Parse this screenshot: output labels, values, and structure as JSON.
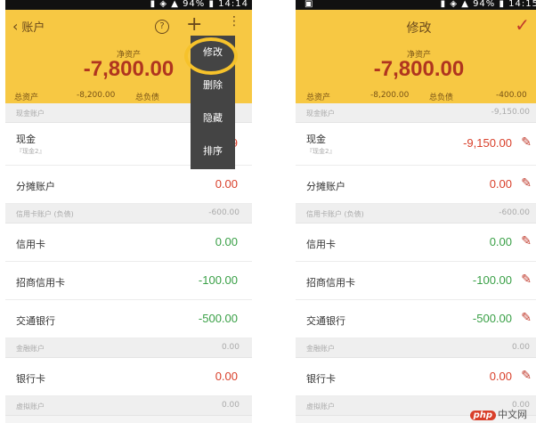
{
  "status_bar": {
    "time_left": "14:14",
    "time_right": "14:15",
    "battery": "94%"
  },
  "left": {
    "back_label": "账户",
    "net_label": "净资产",
    "net_value": "-7,800.00",
    "summary": {
      "assets_label": "总资产",
      "assets_value": "-8,200.00",
      "liab_label": "总负债"
    },
    "sections": {
      "cash": "现金账户",
      "credit": "信用卡账户 (负债)",
      "credit_total": "-600.00",
      "finance": "金融账户",
      "finance_total": "0.00",
      "virtual": "虚拟账户",
      "virtual_total": "0.00"
    },
    "rows": {
      "cash_name": "现金",
      "cash_sub": "『现金2』",
      "cash_amt": "-9",
      "split_name": "分摊账户",
      "split_amt": "0.00",
      "credit_name": "信用卡",
      "credit_amt": "0.00",
      "cmb_name": "招商信用卡",
      "cmb_amt": "-100.00",
      "bocom_name": "交通银行",
      "bocom_amt": "-500.00",
      "bank_name": "银行卡",
      "bank_amt": "0.00"
    },
    "menu": [
      "修改",
      "删除",
      "隐藏",
      "排序"
    ]
  },
  "right": {
    "title": "修改",
    "net_label": "净资产",
    "net_value": "-7,800.00",
    "summary": {
      "assets_label": "总资产",
      "assets_value": "-8,200.00",
      "liab_label": "总负债",
      "liab_value": "-400.00"
    },
    "sections": {
      "cash": "现金账户",
      "cash_total": "-9,150.00",
      "credit": "信用卡账户 (负债)",
      "credit_total": "-600.00",
      "finance": "金融账户",
      "finance_total": "0.00",
      "virtual": "虚拟账户",
      "virtual_total": "0.00"
    },
    "rows": {
      "cash_name": "现金",
      "cash_sub": "『现金2』",
      "cash_amt": "-9,150.00",
      "split_name": "分摊账户",
      "split_amt": "0.00",
      "credit_name": "信用卡",
      "credit_amt": "0.00",
      "cmb_name": "招商信用卡",
      "cmb_amt": "-100.00",
      "bocom_name": "交通银行",
      "bocom_amt": "-500.00",
      "bank_name": "银行卡",
      "bank_amt": "0.00"
    }
  },
  "watermark": {
    "badge": "php",
    "text": "中文网"
  }
}
